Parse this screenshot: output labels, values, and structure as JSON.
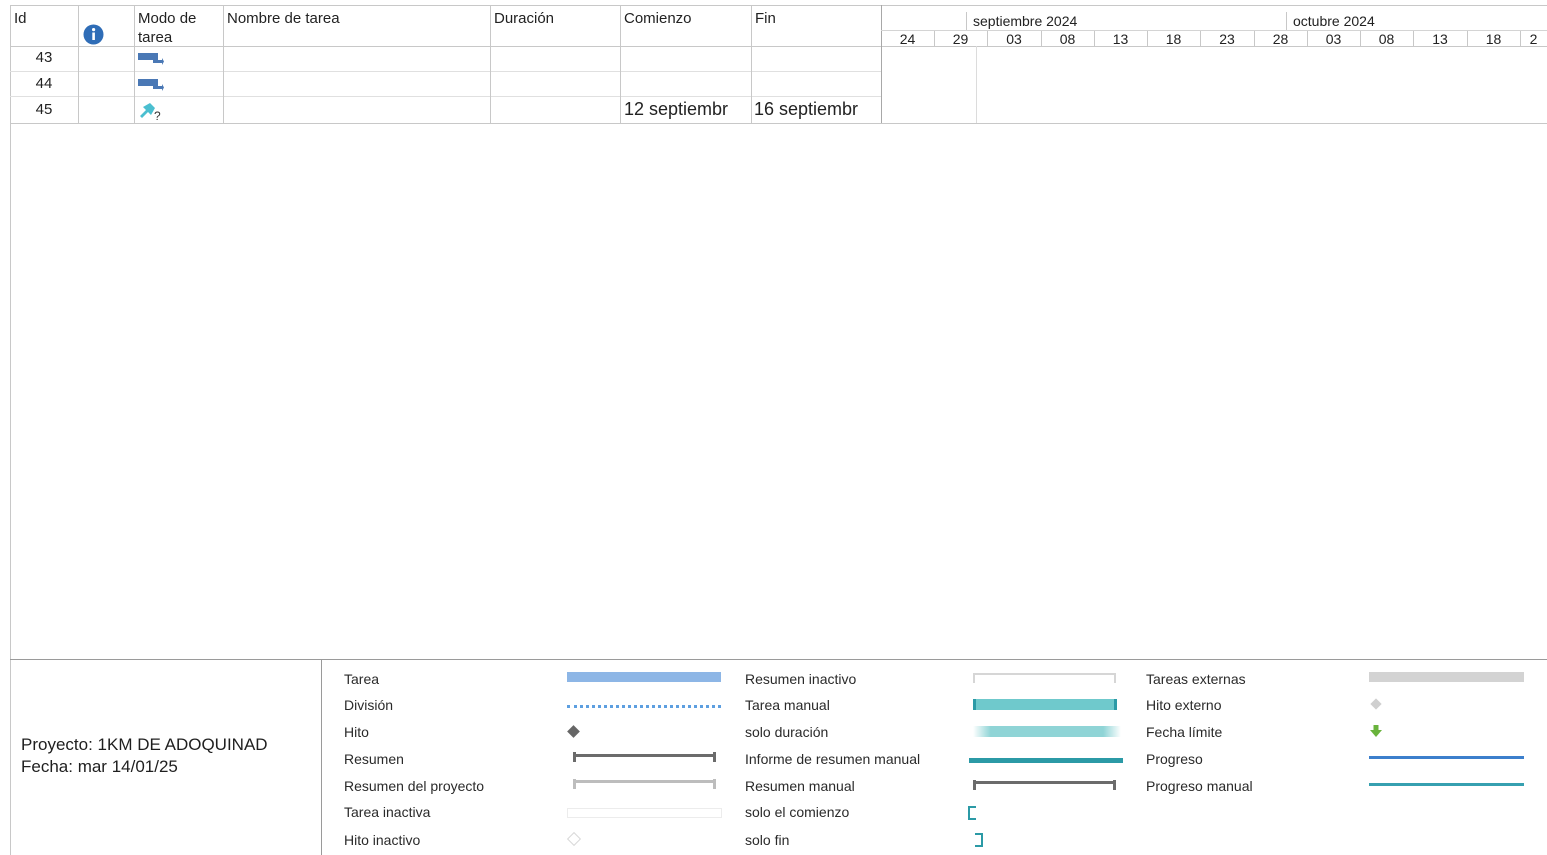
{
  "table": {
    "columns": {
      "id": "Id",
      "mode_line1": "Modo de",
      "mode_line2": "tarea",
      "name": "Nombre de tarea",
      "duration": "Duración",
      "start": "Comienzo",
      "finish": "Fin"
    },
    "rows": [
      {
        "id": "43",
        "mode_icon": "auto-scheduled-task-icon",
        "name": "",
        "duration": "",
        "start": "",
        "finish": ""
      },
      {
        "id": "44",
        "mode_icon": "auto-scheduled-task-icon",
        "name": "",
        "duration": "",
        "start": "",
        "finish": ""
      },
      {
        "id": "45",
        "mode_icon": "manual-pin-task-icon",
        "name": "",
        "duration": "",
        "start": "12 septiembr",
        "finish": "16 septiembr"
      }
    ]
  },
  "timeline": {
    "months": [
      "septiembre 2024",
      "octubre 2024"
    ],
    "days": [
      "24",
      "29",
      "03",
      "08",
      "13",
      "18",
      "23",
      "28",
      "03",
      "08",
      "13",
      "18",
      "2"
    ]
  },
  "legend": {
    "project_line": "Proyecto: 1KM DE ADOQUINAD",
    "date_line": "Fecha: mar 14/01/25",
    "col1": [
      "Tarea",
      "División",
      "Hito",
      "Resumen",
      "Resumen del proyecto",
      "Tarea inactiva",
      "Hito inactivo"
    ],
    "col2": [
      "Resumen inactivo",
      "Tarea manual",
      "solo duración",
      "Informe de resumen manual",
      "Resumen manual",
      "solo el comienzo",
      "solo fin"
    ],
    "col3": [
      "Tareas externas",
      "Hito externo",
      "Fecha límite",
      "Progreso",
      "Progreso manual"
    ]
  },
  "colors": {
    "task": "#8db6e6",
    "manual_task": "#6fc9cc",
    "summary": "#6b6b6b",
    "progress": "#3c7fcc",
    "manual_progress": "#36a0b0",
    "deadline": "#69b33c",
    "info_icon": "#2f6db7"
  }
}
